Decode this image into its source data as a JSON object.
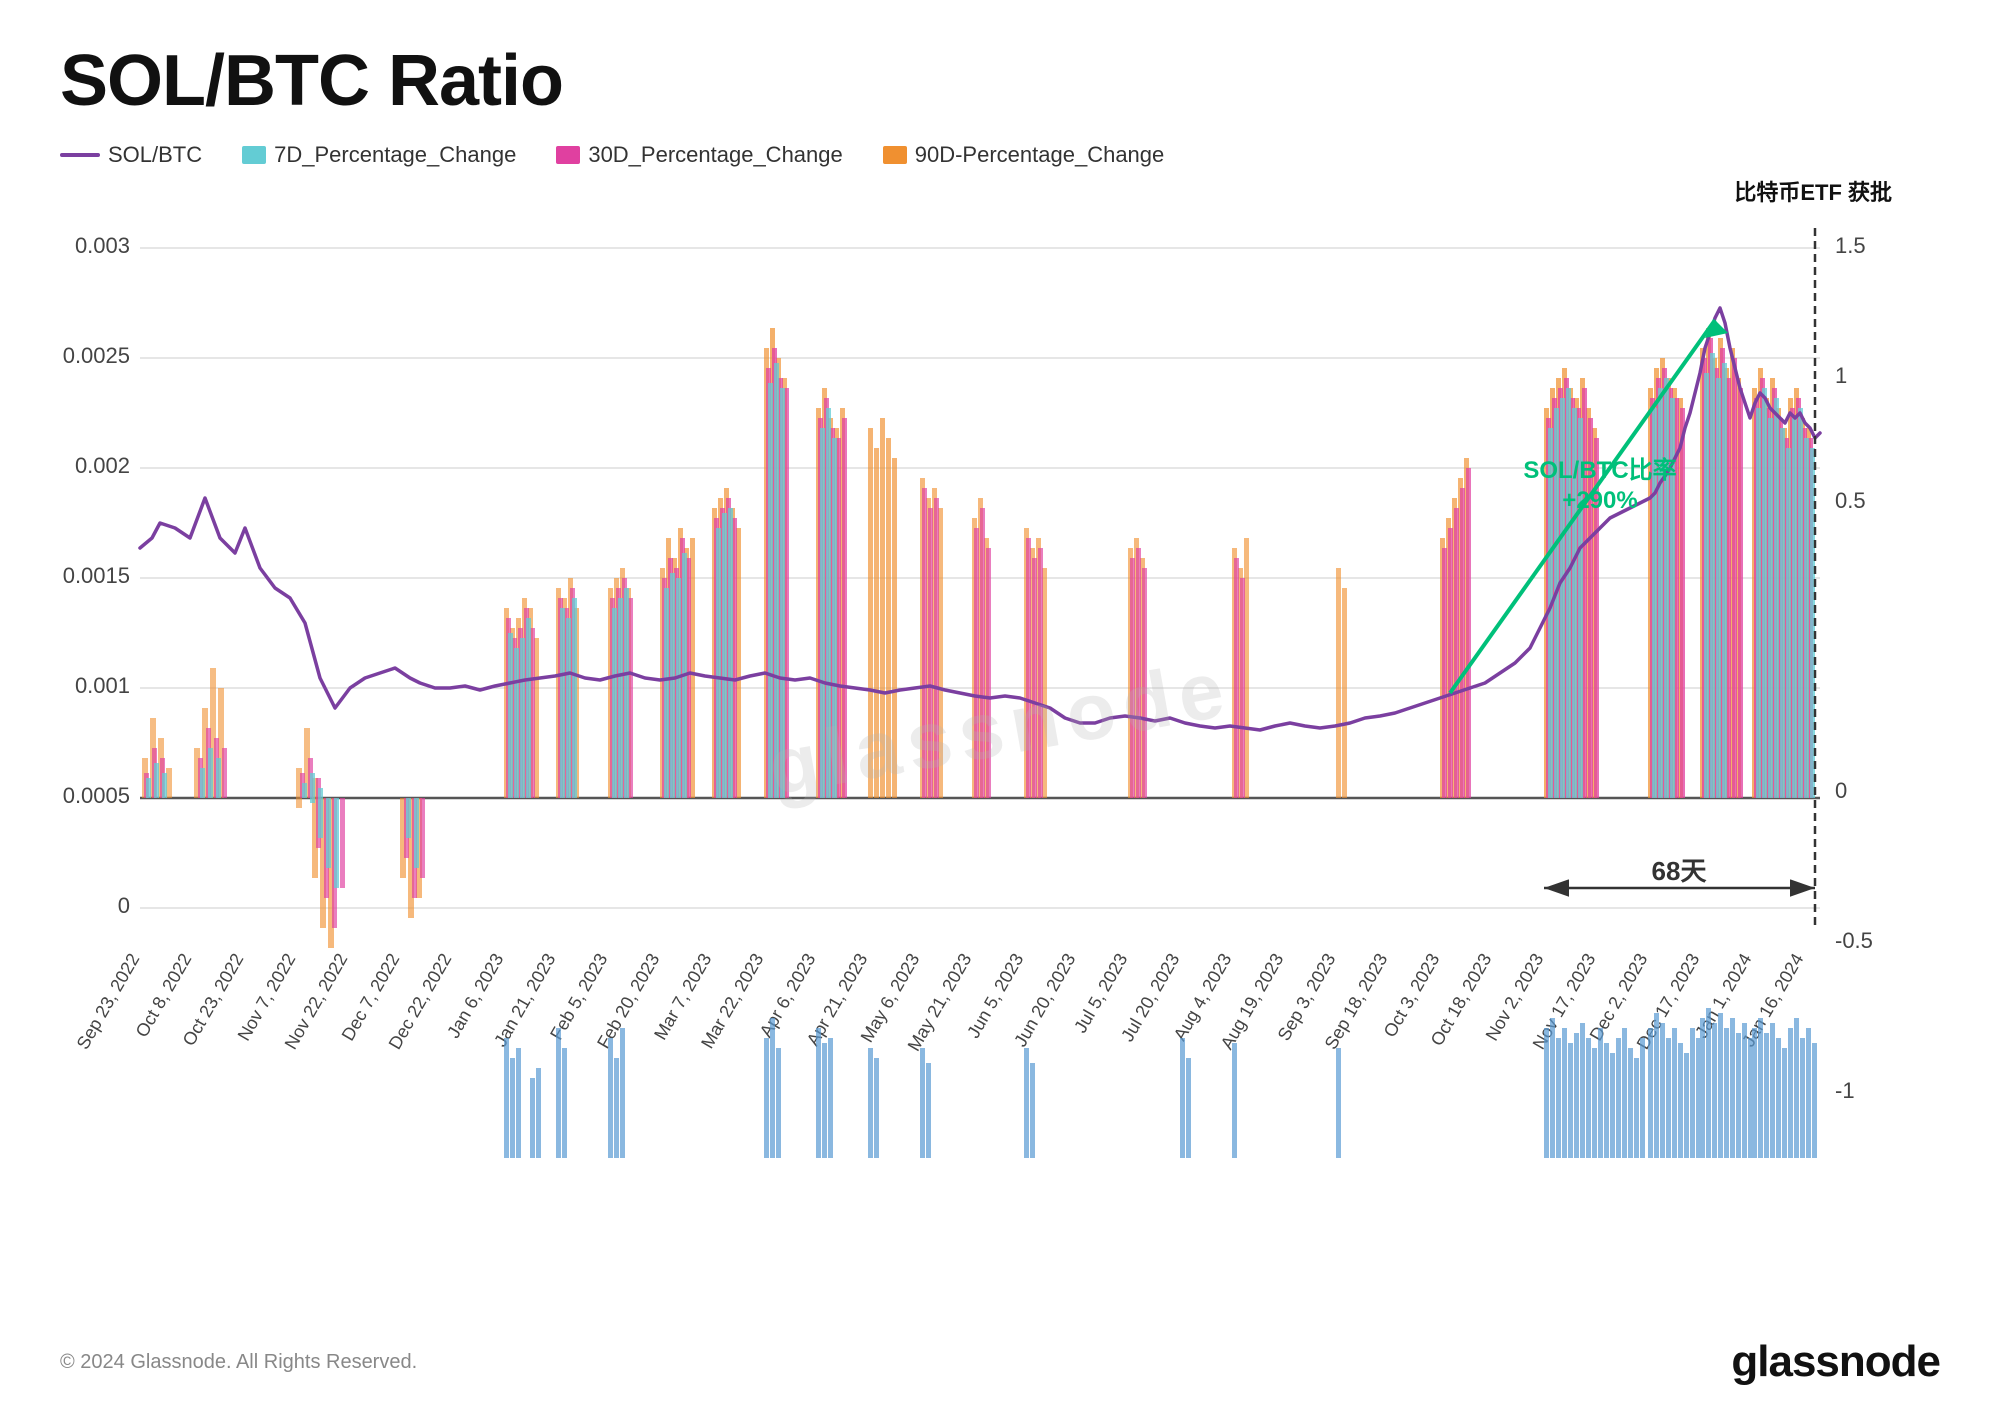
{
  "title": "SOL/BTC Ratio",
  "legend": {
    "items": [
      {
        "label": "SOL/BTC",
        "type": "line",
        "color": "#7b3fa0"
      },
      {
        "label": "7D_Percentage_Change",
        "type": "box",
        "color": "#63ccd4"
      },
      {
        "label": "30D_Percentage_Change",
        "type": "box",
        "color": "#e040a0"
      },
      {
        "label": "90D-Percentage_Change",
        "type": "box",
        "color": "#f09030"
      }
    ]
  },
  "chart": {
    "y_axis_left": [
      "0.003",
      "0.0025",
      "0.002",
      "0.0015",
      "0.001",
      "0.0005",
      "0"
    ],
    "y_axis_right": [
      "1.5",
      "1",
      "0.5",
      "0",
      "-0.5",
      "-1"
    ],
    "x_axis": [
      "Sep 23, 2022",
      "Oct 8, 2022",
      "Oct 23, 2022",
      "Nov 7, 2022",
      "Nov 22, 2022",
      "Dec 7, 2022",
      "Dec 22, 2022",
      "Jan 6, 2023",
      "Jan 21, 2023",
      "Feb 5, 2023",
      "Feb 20, 2023",
      "Mar 7, 2023",
      "Mar 22, 2023",
      "Apr 6, 2023",
      "Apr 21, 2023",
      "May 6, 2023",
      "May 21, 2023",
      "Jun 5, 2023",
      "Jun 20, 2023",
      "Jul 5, 2023",
      "Jul 20, 2023",
      "Aug 4, 2023",
      "Aug 19, 2023",
      "Sep 3, 2023",
      "Sep 18, 2023",
      "Oct 3, 2023",
      "Oct 18, 2023",
      "Nov 2, 2023",
      "Nov 17, 2023",
      "Dec 2, 2023",
      "Dec 17, 2023",
      "Jan 1, 2024",
      "Jan 16, 2024"
    ],
    "annotation_text": "SOL/BTC比率\n+290%",
    "annotation_color": "#00c07a",
    "etf_label": "比特币ETF\n获批",
    "days_label": "68天"
  },
  "footer": {
    "copyright": "© 2024 Glassnode. All Rights Reserved.",
    "brand": "glassnode"
  }
}
